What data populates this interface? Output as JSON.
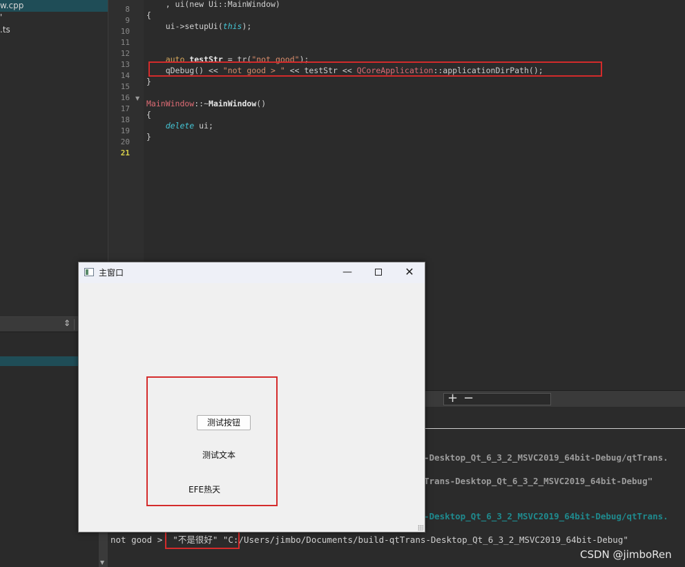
{
  "project": {
    "files": [
      {
        "name": "w.cpp"
      },
      {
        "name": "'"
      },
      {
        "name": ".ts"
      }
    ]
  },
  "editor": {
    "line_numbers": [
      "8",
      "9",
      "10",
      "11",
      "12",
      "13",
      "14",
      "15",
      "16",
      "17",
      "18",
      "19",
      "20",
      "21"
    ],
    "current_line": "21",
    "lines": [
      {
        "top": "-2",
        "parts": [
          [
            "plain",
            "    , ui(new Ui::MainWindow)"
          ]
        ]
      },
      {
        "top": "14",
        "parts": [
          [
            "plain",
            "{"
          ]
        ]
      },
      {
        "top": "30",
        "parts": [
          [
            "plain",
            "    ui->setupUi("
          ],
          [
            "it",
            "this"
          ],
          [
            "plain",
            ");"
          ]
        ]
      },
      {
        "top": "46",
        "parts": []
      },
      {
        "top": "62",
        "parts": []
      },
      {
        "top": "78",
        "parts": [
          [
            "kw",
            "    auto "
          ],
          [
            "bold",
            "testStr"
          ],
          [
            "plain",
            " = tr("
          ],
          [
            "str",
            "\"not good\""
          ],
          [
            "plain",
            ");"
          ]
        ]
      },
      {
        "top": "94",
        "parts": [
          [
            "plain",
            "    qDebug() << "
          ],
          [
            "str",
            "\"not good > \""
          ],
          [
            "plain",
            " << testStr << "
          ],
          [
            "cls",
            "QCoreApplication"
          ],
          [
            "plain",
            "::applicationDirPath();"
          ]
        ]
      },
      {
        "top": "110",
        "parts": [
          [
            "plain",
            "}"
          ]
        ]
      },
      {
        "top": "126",
        "parts": []
      },
      {
        "top": "142",
        "parts": [
          [
            "cls",
            "MainWindow"
          ],
          [
            "plain",
            "::~"
          ],
          [
            "bold",
            "MainWindow"
          ],
          [
            "plain",
            "()"
          ]
        ]
      },
      {
        "top": "158",
        "parts": [
          [
            "plain",
            "{"
          ]
        ]
      },
      {
        "top": "174",
        "parts": [
          [
            "it",
            "    delete "
          ],
          [
            "plain",
            "ui;"
          ]
        ]
      },
      {
        "top": "190",
        "parts": [
          [
            "plain",
            "}"
          ]
        ]
      }
    ]
  },
  "output": {
    "lines": [
      {
        "cls": "gray",
        "text": "-Desktop_Qt_6_3_2_MSVC2019_64bit-Debug/qtTrans."
      },
      {
        "cls": "gray",
        "text": "Trans-Desktop_Qt_6_3_2_MSVC2019_64bit-Debug\""
      },
      {
        "cls": "teal",
        "text": "-Desktop_Qt_6_3_2_MSVC2019_64bit-Debug/qtTrans."
      }
    ],
    "last_line": "not good >  \"不是很好\" \"C:/Users/jimbo/Documents/build-qtTrans-Desktop_Qt_6_3_2_MSVC2019_64bit-Debug\""
  },
  "window": {
    "title": "主窗口",
    "minimize": "—",
    "close": "✕",
    "button_label": "测试按钮",
    "label_text": "测试文本",
    "label_efe": "EFE热天"
  },
  "output_toolbar": {
    "plus": "+",
    "minus": "−"
  },
  "watermark": "CSDN @jimboRen",
  "colors": {
    "highlight_box": "#d42b2b",
    "selection": "#1f4d57"
  },
  "icons": [
    "up-down-arrow-icon",
    "app-window-icon",
    "minimize-icon",
    "maximize-icon",
    "close-icon",
    "plus-icon",
    "minus-icon"
  ]
}
